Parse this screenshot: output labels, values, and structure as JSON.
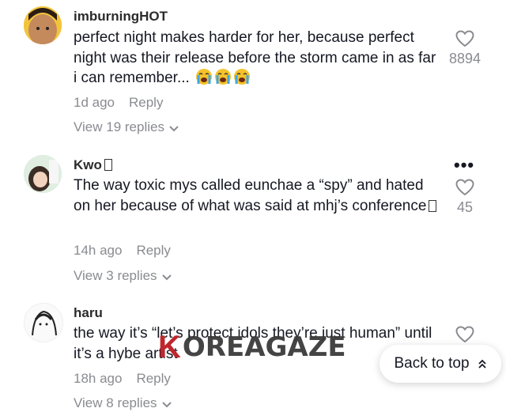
{
  "comments": [
    {
      "username": "imburningHOT",
      "text": "perfect night makes harder for her, because perfect night was their release before the storm came in as far i can remember...",
      "time": "1d ago",
      "reply_label": "Reply",
      "view_replies": "View 19 replies",
      "likes": "8894"
    },
    {
      "username": "Kwo",
      "text": "The way toxic mys called eunchae a “spy” and hated on her because of what was said at mhj’s conference",
      "time": "14h ago",
      "reply_label": "Reply",
      "view_replies": "View 3 replies",
      "likes": "45"
    },
    {
      "username": "haru",
      "text": "the way it’s “let’s protect idols they’re just human” until it’s a hybe artist",
      "time": "18h ago",
      "reply_label": "Reply",
      "view_replies": "View 8 replies",
      "likes": ""
    }
  ],
  "watermark": {
    "letter": "K",
    "rest": "OREAGAZE"
  },
  "back_to_top": "Back to top",
  "colors": {
    "meta_gray": "#8a8b91",
    "text": "#161823",
    "watermark_red": "#c0262d"
  }
}
